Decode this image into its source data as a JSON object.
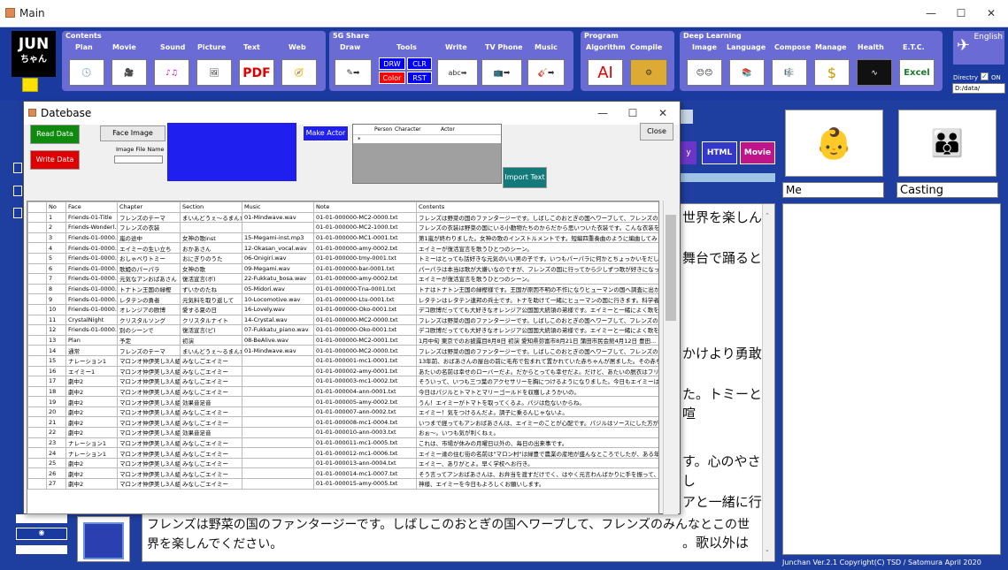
{
  "main_window": {
    "title": "Main"
  },
  "toolbar": {
    "logo": {
      "line1": "JUN",
      "line2": "ちゃん"
    },
    "groups": [
      {
        "name": "Contents",
        "items": [
          "Plan",
          "Movie",
          "Sound",
          "Picture",
          "Text",
          "Web"
        ]
      },
      {
        "name": "5G Share",
        "items": [
          "Draw",
          "Tools",
          "Write",
          "TV Phone",
          "Music"
        ]
      },
      {
        "name": "Program",
        "items": [
          "Algorithm",
          "Compile"
        ]
      },
      {
        "name": "Deep Learning",
        "items": [
          "Image",
          "Language",
          "Compose",
          "Manage",
          "Health",
          "E.T.C."
        ]
      }
    ],
    "tools_labels": [
      "DRW",
      "CLR",
      "Color",
      "RST"
    ],
    "text_icon": "PDF",
    "ai_icon": "AI",
    "excel_icon": "Excel",
    "english_label": "English",
    "directory_label": "Directry",
    "on_label": "ON",
    "directory_value": "D:/data/"
  },
  "right_panel": {
    "html_button": "HTML",
    "movie_button": "Movie",
    "me_label": "Me",
    "casting_label": "Casting"
  },
  "story": {
    "visible_fragments": [
      "世界を楽しん",
      "舞台で踊ると",
      "かけより勇敢",
      "た。トミーと喧",
      "す。心のやさし",
      "アと一緒に行",
      "。歌以外は"
    ],
    "bottom_text": "フレンズは野菜の国のファンタージーです。しばしこのおとぎの国へワープして、フレンズのみんなとこの世界を楽しんでください。"
  },
  "footer": "Junchan Ver.2.1 Copyright(C) TSD / Satomura April 2020",
  "dialog": {
    "title": "Datebase",
    "read_data": "Read Data",
    "write_data": "Write Data",
    "face_image": "Face Image",
    "image_file_name": "Image File Name",
    "make_actor": "Make Actor",
    "close": "Close",
    "import_text": "Import Text",
    "actor_columns": [
      "Person",
      "Character",
      "Actor"
    ],
    "actor_row_marker": "*"
  },
  "table": {
    "columns": [
      "No",
      "Face",
      "Chapter",
      "Section",
      "Music",
      "Note",
      "Contents"
    ],
    "rows": [
      [
        "1",
        "Friends-01-Title",
        "フレンズのテーマ",
        "まいんどうぇ～るまんたん",
        "01-Mindwave.wav",
        "01-01-000000-MC2-0000.txt",
        "フレンズは野菜の国のファンタージーです。しばしこのおとぎの国へワープして、フレンズのみんなとこの世界を..."
      ],
      [
        "2",
        "Friends-Wonderl...",
        "フレンズの衣装",
        "",
        "",
        "01-01-000000-MC2-1000.txt",
        "フレンズの衣装は野菜の国にいる小動物たちのからだから思いついた衣装です。こんな衣装を着て子供たちが舞台..."
      ],
      [
        "3",
        "Friends-01-0000...",
        "嵐の途中",
        "女神の歌inst",
        "15-Megami-inst.mp3",
        "01-01-000000-MC1-0001.txt",
        "第1嵐が終わりました。女神の歌のインストルメントです。短編四重奏曲のように編曲してみました。"
      ],
      [
        "4",
        "Friends-01-0000...",
        "エイミーの生い立ち",
        "おかあさん",
        "12-Okasan_vocal.wav",
        "01-01-000000-amy-0002.txt",
        "エイミーが復活宣言を歌うひとつのシーン。"
      ],
      [
        "5",
        "Friends-01-0000...",
        "おしゃべりトミー",
        "おにぎりのうた",
        "06-Onigiri.wav",
        "01-01-000000-tmy-0001.txt",
        "トミーはとっても話好きな元気のいい男の子です。いつもパーパラに何かとちょっかいをだしていますが、見かけよ..."
      ],
      [
        "6",
        "Friends-01-0000...",
        "歌姫のパーパラ",
        "女神の歌",
        "09-Megami.wav",
        "01-01-000000-bar-0001.txt",
        "パーパラは本当は歌が大嫌いなのですが、フレンズの国に行ってから少しずつ歌が好きになってきました。トミ..."
      ],
      [
        "7",
        "Friends-01-0000...",
        "元気なアンおばあさん",
        "復活宣言(ボ)",
        "22-Fukkatu_bosa.wav",
        "01-01-000000-amy-0002.txt",
        "エイミーが復活宣言を歌うひとつのシーン。"
      ],
      [
        "8",
        "Friends-01-0000...",
        "トナトン王国の緑樫",
        "ずいかのたね",
        "05-Midori.wav",
        "01-01-000000-Tna-0001.txt",
        "トナはトナトン王国の緑樫様です。王国が原因不明の不作になりヒューマンの国へ調査に出かけます。心..."
      ],
      [
        "9",
        "Friends-01-0000...",
        "レタテンの勇者",
        "元気料を取り返して",
        "10-Locomotive.wav",
        "01-01-000000-Ltu-0001.txt",
        "レタテンはレタテン連邦の兵士です。トナを助けて一緒にヒューマンの国に行きます。科学者クラウンアと一..."
      ],
      [
        "10",
        "Friends-01-0000...",
        "オレンジアの欧博",
        "愛する夏の日",
        "16-Lovely.wav",
        "01-01-000000-Oko-0001.txt",
        "デコ欧博だってても大好きなオレンジア公国国大統領の弟様です。エイミーと一緒によく歌を歌います。歌..."
      ],
      [
        "11",
        "CrystalNight",
        "クリスタルソング",
        "クリスタルナイト",
        "14-Crystal.wav",
        "01-01-000000-MC2-0000.txt",
        "フレンズは野菜の国のファンタージーです。しばしこのおとぎの国へワープして、フレンズのみんなとこの世界を..."
      ],
      [
        "12",
        "Friends-01-0000...",
        "別のシーンで",
        "復活宣言(ピ)",
        "07-Fukkatu_piano.wav",
        "01-01-000000-Oko-0001.txt",
        "デコ欧博だってても大好きなオレンジア公国国大統領の弟様です。エイミーと一緒によく歌を歌います。歌..."
      ],
      [
        "13",
        "Plan",
        "予定",
        "初演",
        "08-BeAlive.wav",
        "01-01-000000-MC2-0001.txt",
        "1月中旬 東京でのお披露目8月8日 初演 愛知県弥富市8月21日 蒲田市民会館4月12日 豊田..."
      ],
      [
        "14",
        "通常",
        "フレンズのテーマ",
        "まいんどうぇ～るまんたん",
        "01-Mindwave.wav",
        "01-01-000000-MC2-0000.txt",
        "フレンズは野菜の国のファンタージーです。しばしこのおとぎの国へワープして、フレンズのみんなとこの世界を..."
      ],
      [
        "15",
        "ナレーション1",
        "マロンオ仲伊美し3人組",
        "みなしごエイミー",
        "",
        "01-01-000001-mc1-0001.txt",
        "13年前、おばあさんの屋台の前に毛布で包まれて置かれていた赤ちゃんが居ました。その赤ちゃんの名前..."
      ],
      [
        "16",
        "エイミー1",
        "マロンオ仲伊美し3人組",
        "みなしごエイミー",
        "",
        "01-01-000002-amy-0001.txt",
        "あたいの名前は幸せのローバーだよ。だからとっても幸せだよ。だけど、あたいの脱衣はフリーリーフス。お..."
      ],
      [
        "17",
        "劇中2",
        "マロンオ仲伊美し3人組",
        "みなしごエイミー",
        "",
        "01-01-000003-mc1-0002.txt",
        "そういって、いつも三つ葉のアクセサリーを胸につけるようになりました。今日もエイミーは学起きて家の周り..."
      ],
      [
        "18",
        "劇中2",
        "マロンオ仲伊美し3人組",
        "みなしごエイミー",
        "",
        "01-01-000004-ann-0001.txt",
        "今日はパジルとトマトとマリーゴールドを収穫しようかいの。"
      ],
      [
        "19",
        "劇中2",
        "マロンオ仲伊美し3人組",
        "効果音足音",
        "",
        "01-01-000005-amy-0002.txt",
        "うん！エイミーがトマトを取ってくるよ。パジは危ないからね。"
      ],
      [
        "20",
        "劇中2",
        "マロンオ仲伊美し3人組",
        "みなしごエイミー",
        "",
        "01-01-000007-ann-0002.txt",
        "エイミー！気をつけるんだよ。調子に乗るんじゃないよ。"
      ],
      [
        "21",
        "劇中2",
        "マロンオ仲伊美し3人組",
        "みなしごエイミー",
        "",
        "01-01-000008-mc1-0004.txt",
        "いつまで経ってもアンおばあさんは、エイミーのことが心配です。パジルはソースにした方が高く売れるので、..."
      ],
      [
        "22",
        "劇中2",
        "マロンオ仲伊美し3人組",
        "効果音足音",
        "",
        "01-01-000010-ann-0003.txt",
        "おぉ～。いつも気が利くねぇ。"
      ],
      [
        "23",
        "ナレーション1",
        "マロンオ仲伊美し3人組",
        "みなしごエイミー",
        "",
        "01-01-000011-mc1-0005.txt",
        "これは、市場が休みの月曜日以外の、毎日の出来事です。"
      ],
      [
        "24",
        "ナレーション1",
        "マロンオ仲伊美し3人組",
        "みなしごエイミー",
        "",
        "01-01-000012-mc1-0006.txt",
        "エイミー達の住む街の名前は\"マロン村\"は緑豊で農業の産地が盛んなところでしたが、ある年の大洪水で畑..."
      ],
      [
        "25",
        "劇中2",
        "マロンオ仲伊美し3人組",
        "みなしごエイミー",
        "",
        "01-01-000013-ann-0004.txt",
        "エイミー、ありがとよ。早く学校へお行き。"
      ],
      [
        "26",
        "劇中2",
        "マロンオ仲伊美し3人組",
        "みなしごエイミー",
        "",
        "01-01-000014-mc1-0007.txt",
        "そう言ってアンおばあさんは、お弁当を渡すだけでく、はやく元言わんばかりに手を振って、十字を切りお祈..."
      ],
      [
        "27",
        "劇中2",
        "マロンオ仲伊美し3人組",
        "みなしごエイミー",
        "",
        "01-01-000015-amy-0005.txt",
        "神様、エイミーを今日もよろしくお願いします。"
      ]
    ]
  }
}
